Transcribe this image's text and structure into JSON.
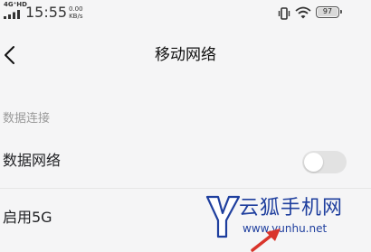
{
  "status_bar": {
    "network": "4G⁺HD",
    "time": "15:55",
    "speed_value": "0.00",
    "speed_unit": "KB/s",
    "battery": "97",
    "icons": [
      "signal-bars-icon",
      "vibrate-icon",
      "wifi-icon",
      "battery-icon"
    ]
  },
  "header": {
    "back_icon": "chevron-left-icon",
    "title": "移动网络"
  },
  "section": {
    "label": "数据连接"
  },
  "rows": [
    {
      "label": "数据网络",
      "toggle": "off"
    },
    {
      "label": "启用5G"
    }
  ],
  "watermark": {
    "text": "云狐手机网",
    "url": "www.yunhu.net",
    "logo_letter": "Y"
  },
  "colors": {
    "background": "#f5f5f6",
    "toggle_off": "#e2e2e2",
    "section_text": "#9a9a9a",
    "watermark": "#1f3f9e",
    "arrow": "#d9342b"
  }
}
